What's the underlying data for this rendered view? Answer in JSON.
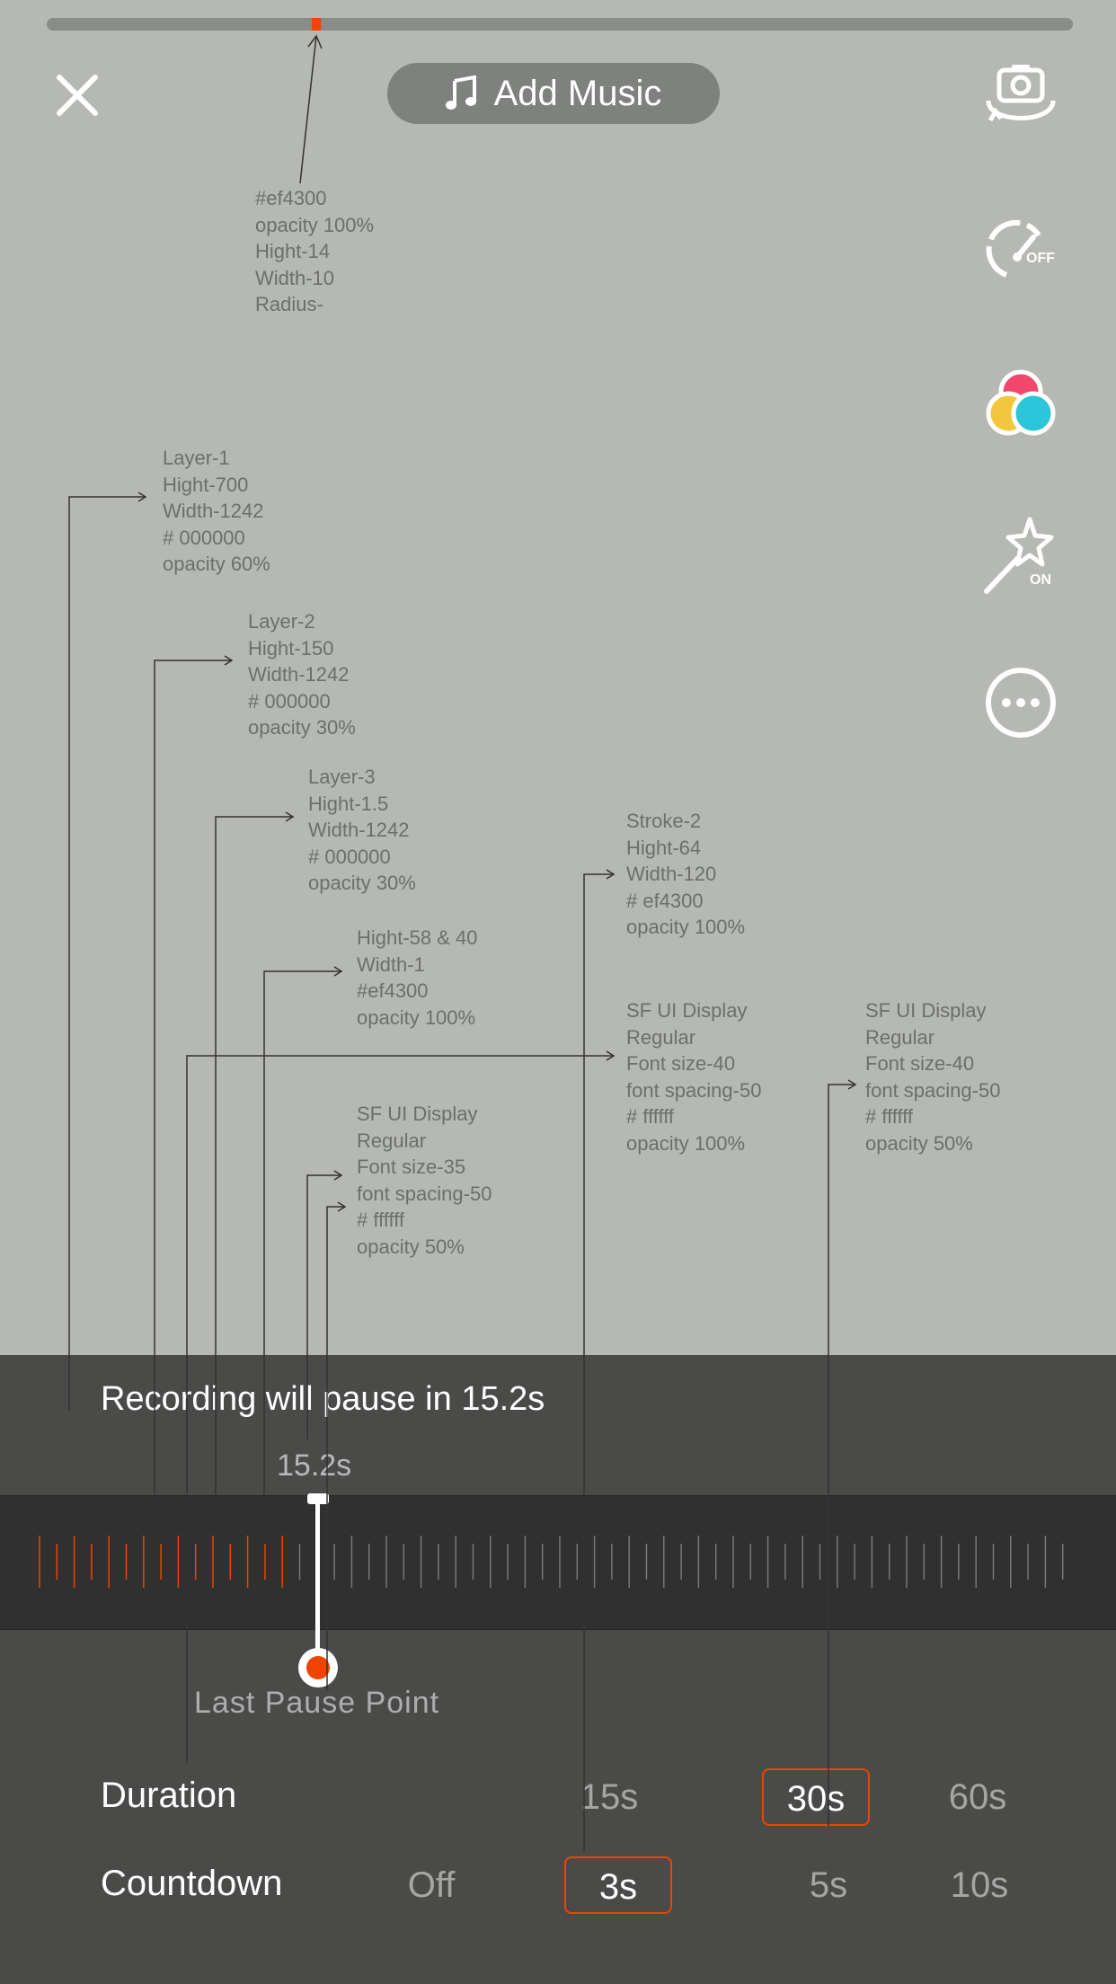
{
  "top_bar": {
    "close_icon": "close-icon",
    "add_music_label": "Add Music",
    "music_icon": "music-note-icon"
  },
  "side_icons": [
    {
      "name": "flip-camera-icon"
    },
    {
      "name": "speed-icon",
      "badge": "OFF"
    },
    {
      "name": "filters-icon"
    },
    {
      "name": "beauty-icon",
      "badge": "ON"
    },
    {
      "name": "more-icon"
    }
  ],
  "colors": {
    "accent": "#ef4300"
  },
  "annotations": {
    "marker": "#ef4300\nopacity 100%\nHight-14\nWidth-10\nRadius-",
    "layer1": "Layer-1\nHight-700\nWidth-1242\n# 000000\nopacity 60%",
    "layer2": "Layer-2\nHight-150\nWidth-1242\n# 000000\nopacity 30%",
    "layer3": "Layer-3\nHight-1.5\nWidth-1242\n# 000000\nopacity 30%",
    "tick": "Hight-58 & 40\nWidth-1\n#ef4300\nopacity 100%",
    "font35": "SF UI Display\nRegular\nFont size-35\nfont spacing-50\n# ffffff\nopacity 50%",
    "stroke2": "Stroke-2\nHight-64\nWidth-120\n# ef4300\nopacity 100%",
    "font40_100": "SF UI Display\nRegular\nFont size-40\nfont spacing-50\n# ffffff\nopacity 100%",
    "font40_50": "SF UI Display\nRegular\nFont size-40\nfont spacing-50\n# ffffff\nopacity 50%"
  },
  "recording": {
    "pause_message": "Recording will pause in 15.2s",
    "current_time": "15.2s",
    "progress_fraction": 0.25,
    "last_pause_label": "Last Pause Point"
  },
  "duration": {
    "label": "Duration",
    "options": [
      "15s",
      "30s",
      "60s"
    ],
    "selected": "30s"
  },
  "countdown": {
    "label": "Countdown",
    "options": [
      "Off",
      "3s",
      "5s",
      "10s"
    ],
    "selected": "3s"
  }
}
